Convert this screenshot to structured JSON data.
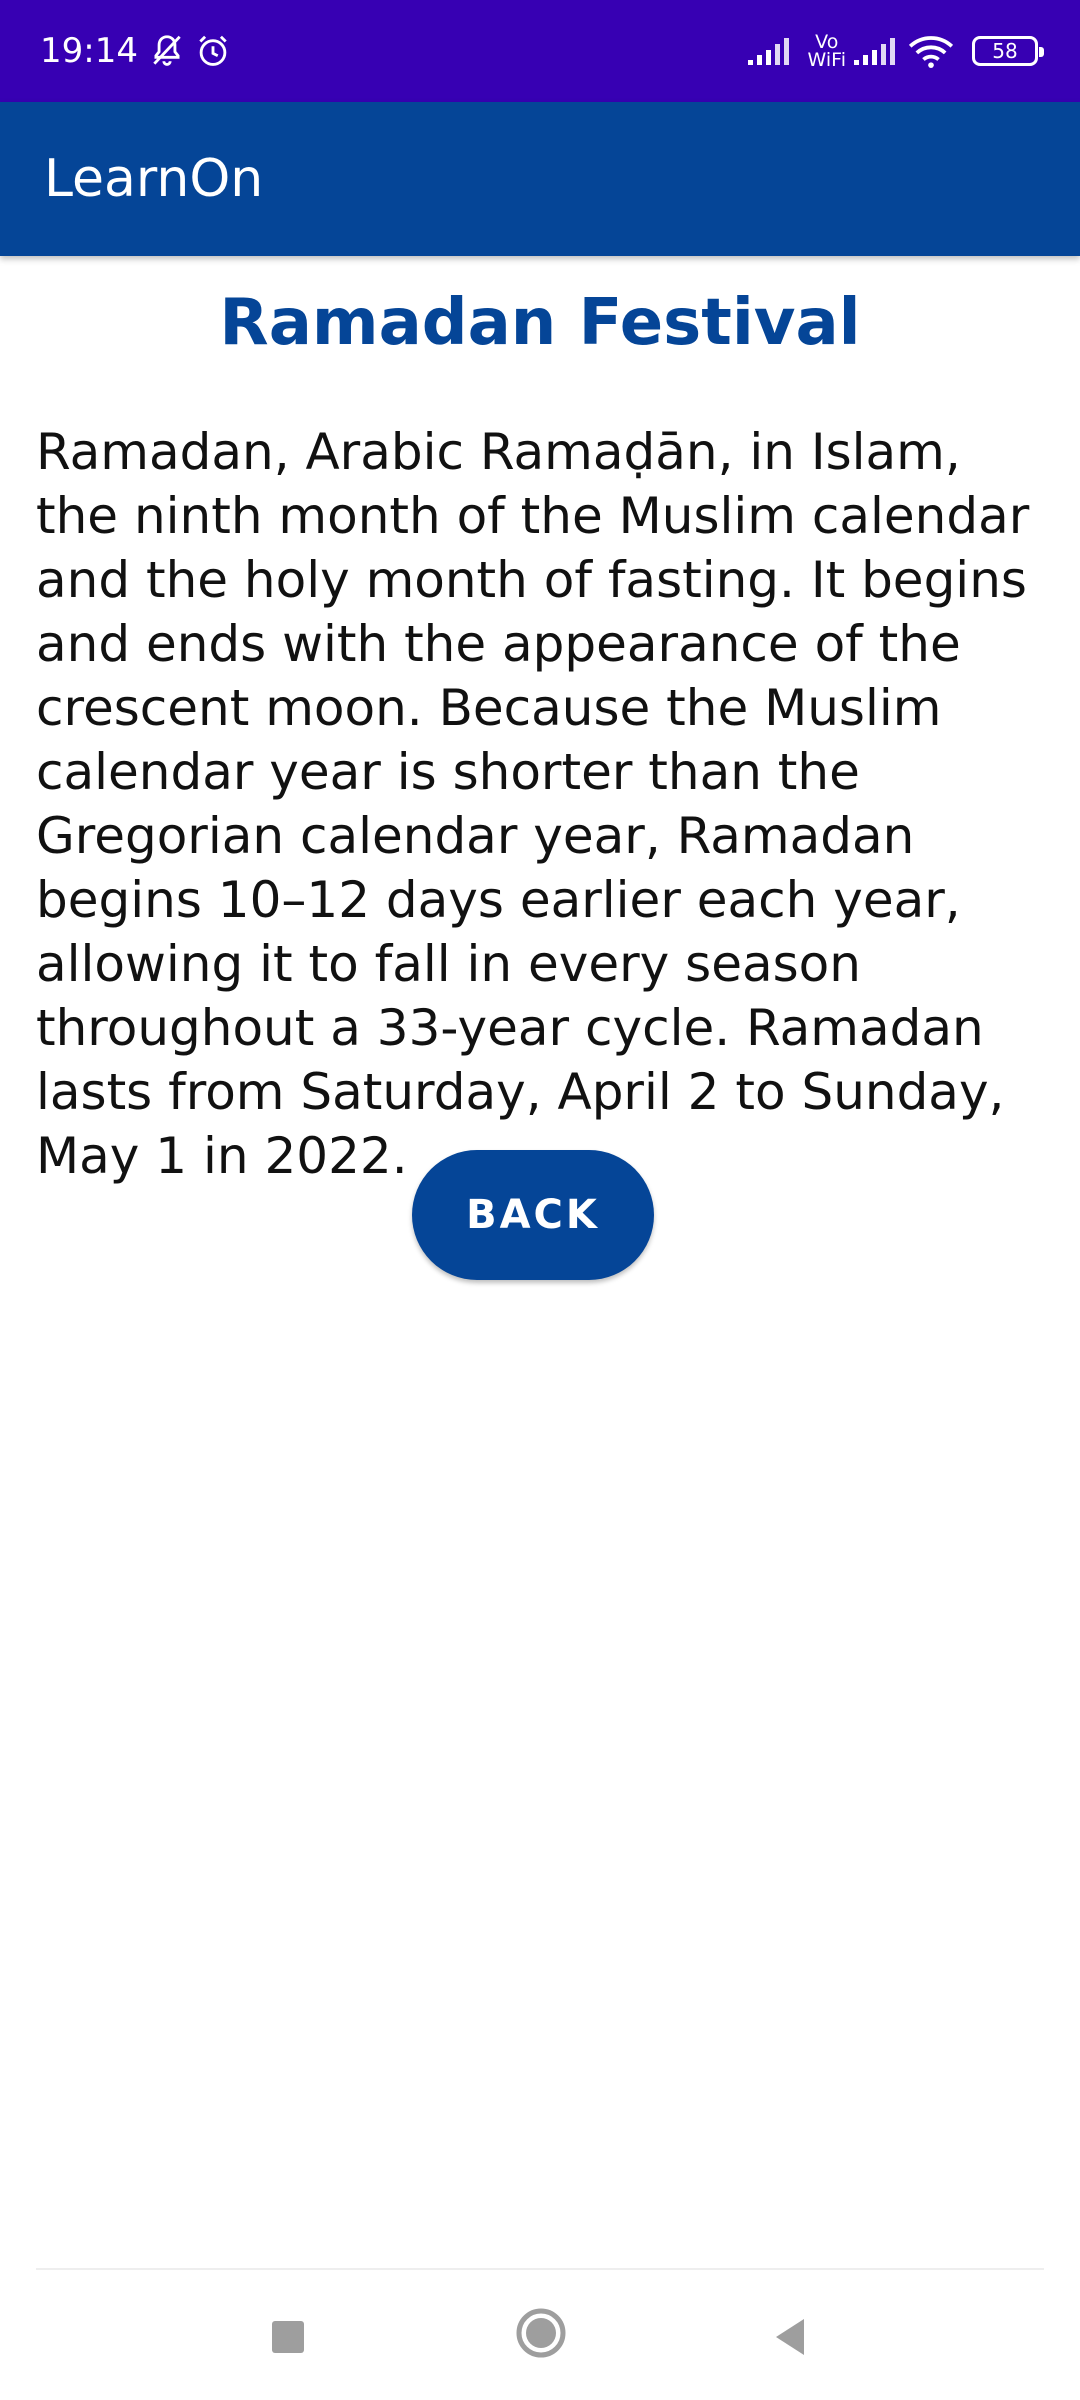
{
  "status_bar": {
    "time": "19:14",
    "vowifi_top": "Vo",
    "vowifi_bottom": "WiFi",
    "battery_level": "58",
    "icons": [
      "muted-bell-icon",
      "alarm-icon",
      "signal-icon",
      "vowifi-icon",
      "signal-icon",
      "wifi-icon",
      "battery-icon"
    ]
  },
  "app_bar": {
    "title": "LearnOn"
  },
  "main": {
    "title": "Ramadan Festival",
    "body": "Ramadan, Arabic Ramaḍān, in Islam, the ninth month of the Muslim calendar and the holy month of fasting. It begins and ends with the appearance of the crescent moon. Because the Muslim calendar year is shorter than the Gregorian calendar year, Ramadan begins 10–12 days earlier each year, allowing it to fall in every season throughout a 33-year cycle. Ramadan lasts from Saturday, April 2 to Sunday, May 1 in 2022.",
    "back_label": "BACK"
  },
  "nav_bar": {
    "icons": [
      "recent-apps-icon",
      "home-icon",
      "back-icon"
    ]
  },
  "colors": {
    "status_bar": "#3700b3",
    "app_bar": "#054597",
    "title": "#054597",
    "button": "#054597",
    "text": "#111111"
  }
}
